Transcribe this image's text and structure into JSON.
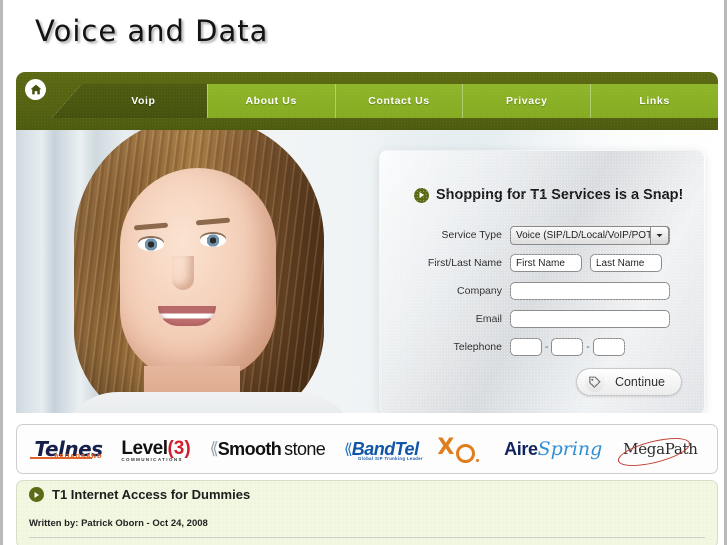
{
  "site": {
    "logo_text": "Voice and Data"
  },
  "nav": {
    "home_icon": "home-icon",
    "items": [
      {
        "label": "Voip",
        "active": true
      },
      {
        "label": "About Us",
        "active": false
      },
      {
        "label": "Contact Us",
        "active": false
      },
      {
        "label": "Privacy",
        "active": false
      },
      {
        "label": "Links",
        "active": false
      }
    ]
  },
  "hero": {
    "photo_alt": "smiling woman portrait"
  },
  "form": {
    "bullet_icon": "play-triangle-icon",
    "title": "Shopping for T1 Services is a Snap!",
    "fields": {
      "service_type_label": "Service Type",
      "service_type_value": "Voice (SIP/LD/Local/VoIP/POTS)",
      "name_label": "First/Last Name",
      "first_name_placeholder": "First Name",
      "last_name_placeholder": "Last Name",
      "company_label": "Company",
      "company_value": "",
      "email_label": "Email",
      "email_value": "",
      "telephone_label": "Telephone",
      "tel_area": "",
      "tel_prefix": "",
      "tel_line": "",
      "tel_separator": "-"
    },
    "continue_label": "Continue",
    "continue_icon": "tag-icon"
  },
  "partners": [
    {
      "name": "Telnes",
      "tagline": "BROADBAND"
    },
    {
      "name": "Level",
      "mark": "(3)",
      "tagline": "COMMUNICATIONS"
    },
    {
      "name_bold": "Smooth",
      "name_light": "stone"
    },
    {
      "name": "BandTel",
      "tagline": "Global SIP Trunking Leader"
    },
    {
      "name": "XO"
    },
    {
      "name_bold": "Aire",
      "name_italic": "Spring"
    },
    {
      "name": "MegaPath"
    }
  ],
  "article": {
    "bullet_icon": "play-triangle-icon",
    "title": "T1 Internet Access for Dummies",
    "byline": "Written by: Patrick Oborn - Oct 24, 2008"
  },
  "colors": {
    "nav_light_green": "#8fb52a",
    "nav_dark_green": "#4e5c12",
    "bullet_olive": "#5b6a14",
    "article_bg": "#f2f7e1"
  }
}
